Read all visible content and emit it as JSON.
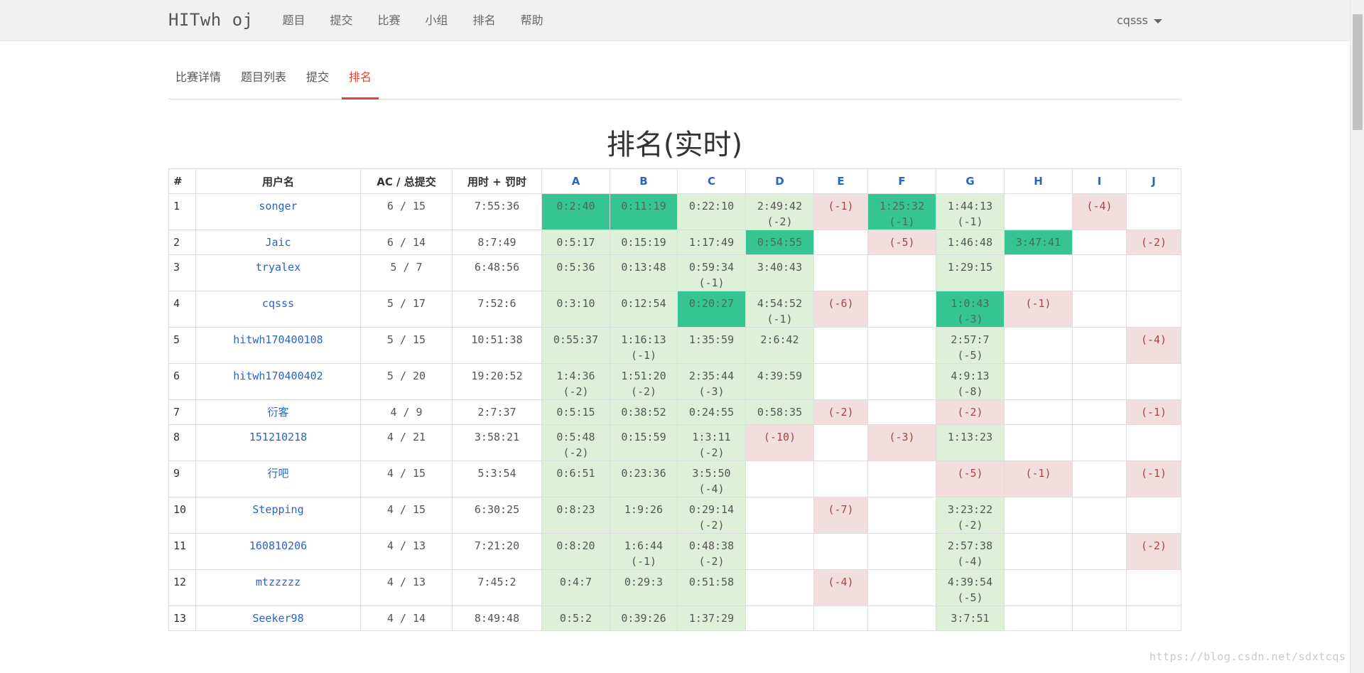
{
  "navbar": {
    "brand": "HITwh oj",
    "items": [
      "题目",
      "提交",
      "比赛",
      "小组",
      "排名",
      "帮助"
    ],
    "user": "cqsss"
  },
  "contest_tabs": [
    "比赛详情",
    "题目列表",
    "提交",
    "排名"
  ],
  "active_tab": "排名",
  "page_title": "排名(实时)",
  "table": {
    "headers": [
      "#",
      "用户名",
      "AC / 总提交",
      "用时 + 罚时"
    ],
    "problems": [
      "A",
      "B",
      "C",
      "D",
      "E",
      "F",
      "G",
      "H",
      "I",
      "J"
    ],
    "rows": [
      {
        "rank": "1",
        "user": "songer",
        "ac": "6 / 15",
        "time": "7:55:36",
        "cells": [
          {
            "s": "fb",
            "t": "0:2:40",
            "p": ""
          },
          {
            "s": "fb",
            "t": "0:11:19",
            "p": ""
          },
          {
            "s": "ac",
            "t": "0:22:10",
            "p": ""
          },
          {
            "s": "ac",
            "t": "2:49:42",
            "p": "(-2)"
          },
          {
            "s": "wa",
            "t": "",
            "p": "(-1)"
          },
          {
            "s": "fb",
            "t": "1:25:32",
            "p": "(-1)"
          },
          {
            "s": "ac",
            "t": "1:44:13",
            "p": "(-1)"
          },
          {
            "s": "",
            "t": "",
            "p": ""
          },
          {
            "s": "wa",
            "t": "",
            "p": "(-4)"
          },
          {
            "s": "",
            "t": "",
            "p": ""
          }
        ]
      },
      {
        "rank": "2",
        "user": "Jaic",
        "ac": "6 / 14",
        "time": "8:7:49",
        "cells": [
          {
            "s": "ac",
            "t": "0:5:17",
            "p": ""
          },
          {
            "s": "ac",
            "t": "0:15:19",
            "p": ""
          },
          {
            "s": "ac",
            "t": "1:17:49",
            "p": ""
          },
          {
            "s": "fb",
            "t": "0:54:55",
            "p": ""
          },
          {
            "s": "",
            "t": "",
            "p": ""
          },
          {
            "s": "wa",
            "t": "",
            "p": "(-5)"
          },
          {
            "s": "ac",
            "t": "1:46:48",
            "p": ""
          },
          {
            "s": "fb",
            "t": "3:47:41",
            "p": ""
          },
          {
            "s": "",
            "t": "",
            "p": ""
          },
          {
            "s": "wa",
            "t": "",
            "p": "(-2)"
          }
        ]
      },
      {
        "rank": "3",
        "user": "tryalex",
        "ac": "5 / 7",
        "time": "6:48:56",
        "cells": [
          {
            "s": "ac",
            "t": "0:5:36",
            "p": ""
          },
          {
            "s": "ac",
            "t": "0:13:48",
            "p": ""
          },
          {
            "s": "ac",
            "t": "0:59:34",
            "p": "(-1)"
          },
          {
            "s": "ac",
            "t": "3:40:43",
            "p": ""
          },
          {
            "s": "",
            "t": "",
            "p": ""
          },
          {
            "s": "",
            "t": "",
            "p": ""
          },
          {
            "s": "ac",
            "t": "1:29:15",
            "p": ""
          },
          {
            "s": "",
            "t": "",
            "p": ""
          },
          {
            "s": "",
            "t": "",
            "p": ""
          },
          {
            "s": "",
            "t": "",
            "p": ""
          }
        ]
      },
      {
        "rank": "4",
        "user": "cqsss",
        "ac": "5 / 17",
        "time": "7:52:6",
        "cells": [
          {
            "s": "ac",
            "t": "0:3:10",
            "p": ""
          },
          {
            "s": "ac",
            "t": "0:12:54",
            "p": ""
          },
          {
            "s": "fb",
            "t": "0:20:27",
            "p": ""
          },
          {
            "s": "ac",
            "t": "4:54:52",
            "p": "(-1)"
          },
          {
            "s": "wa",
            "t": "",
            "p": "(-6)"
          },
          {
            "s": "",
            "t": "",
            "p": ""
          },
          {
            "s": "fb",
            "t": "1:0:43",
            "p": "(-3)"
          },
          {
            "s": "wa",
            "t": "",
            "p": "(-1)"
          },
          {
            "s": "",
            "t": "",
            "p": ""
          },
          {
            "s": "",
            "t": "",
            "p": ""
          }
        ]
      },
      {
        "rank": "5",
        "user": "hitwh170400108",
        "ac": "5 / 15",
        "time": "10:51:38",
        "cells": [
          {
            "s": "ac",
            "t": "0:55:37",
            "p": ""
          },
          {
            "s": "ac",
            "t": "1:16:13",
            "p": "(-1)"
          },
          {
            "s": "ac",
            "t": "1:35:59",
            "p": ""
          },
          {
            "s": "ac",
            "t": "2:6:42",
            "p": ""
          },
          {
            "s": "",
            "t": "",
            "p": ""
          },
          {
            "s": "",
            "t": "",
            "p": ""
          },
          {
            "s": "ac",
            "t": "2:57:7",
            "p": "(-5)"
          },
          {
            "s": "",
            "t": "",
            "p": ""
          },
          {
            "s": "",
            "t": "",
            "p": ""
          },
          {
            "s": "wa",
            "t": "",
            "p": "(-4)"
          }
        ]
      },
      {
        "rank": "6",
        "user": "hitwh170400402",
        "ac": "5 / 20",
        "time": "19:20:52",
        "cells": [
          {
            "s": "ac",
            "t": "1:4:36",
            "p": "(-2)"
          },
          {
            "s": "ac",
            "t": "1:51:20",
            "p": "(-2)"
          },
          {
            "s": "ac",
            "t": "2:35:44",
            "p": "(-3)"
          },
          {
            "s": "ac",
            "t": "4:39:59",
            "p": ""
          },
          {
            "s": "",
            "t": "",
            "p": ""
          },
          {
            "s": "",
            "t": "",
            "p": ""
          },
          {
            "s": "ac",
            "t": "4:9:13",
            "p": "(-8)"
          },
          {
            "s": "",
            "t": "",
            "p": ""
          },
          {
            "s": "",
            "t": "",
            "p": ""
          },
          {
            "s": "",
            "t": "",
            "p": ""
          }
        ]
      },
      {
        "rank": "7",
        "user": "衍客",
        "ac": "4 / 9",
        "time": "2:7:37",
        "cells": [
          {
            "s": "ac",
            "t": "0:5:15",
            "p": ""
          },
          {
            "s": "ac",
            "t": "0:38:52",
            "p": ""
          },
          {
            "s": "ac",
            "t": "0:24:55",
            "p": ""
          },
          {
            "s": "ac",
            "t": "0:58:35",
            "p": ""
          },
          {
            "s": "wa",
            "t": "",
            "p": "(-2)"
          },
          {
            "s": "",
            "t": "",
            "p": ""
          },
          {
            "s": "wa",
            "t": "",
            "p": "(-2)"
          },
          {
            "s": "",
            "t": "",
            "p": ""
          },
          {
            "s": "",
            "t": "",
            "p": ""
          },
          {
            "s": "wa",
            "t": "",
            "p": "(-1)"
          }
        ]
      },
      {
        "rank": "8",
        "user": "151210218",
        "ac": "4 / 21",
        "time": "3:58:21",
        "cells": [
          {
            "s": "ac",
            "t": "0:5:48",
            "p": "(-2)"
          },
          {
            "s": "ac",
            "t": "0:15:59",
            "p": ""
          },
          {
            "s": "ac",
            "t": "1:3:11",
            "p": "(-2)"
          },
          {
            "s": "wa",
            "t": "",
            "p": "(-10)"
          },
          {
            "s": "",
            "t": "",
            "p": ""
          },
          {
            "s": "wa",
            "t": "",
            "p": "(-3)"
          },
          {
            "s": "ac",
            "t": "1:13:23",
            "p": ""
          },
          {
            "s": "",
            "t": "",
            "p": ""
          },
          {
            "s": "",
            "t": "",
            "p": ""
          },
          {
            "s": "",
            "t": "",
            "p": ""
          }
        ]
      },
      {
        "rank": "9",
        "user": "行吧",
        "ac": "4 / 15",
        "time": "5:3:54",
        "cells": [
          {
            "s": "ac",
            "t": "0:6:51",
            "p": ""
          },
          {
            "s": "ac",
            "t": "0:23:36",
            "p": ""
          },
          {
            "s": "ac",
            "t": "3:5:50",
            "p": "(-4)"
          },
          {
            "s": "",
            "t": "",
            "p": ""
          },
          {
            "s": "",
            "t": "",
            "p": ""
          },
          {
            "s": "",
            "t": "",
            "p": ""
          },
          {
            "s": "wa",
            "t": "",
            "p": "(-5)"
          },
          {
            "s": "wa",
            "t": "",
            "p": "(-1)"
          },
          {
            "s": "",
            "t": "",
            "p": ""
          },
          {
            "s": "wa",
            "t": "",
            "p": "(-1)"
          }
        ]
      },
      {
        "rank": "10",
        "user": "Stepping",
        "ac": "4 / 15",
        "time": "6:30:25",
        "cells": [
          {
            "s": "ac",
            "t": "0:8:23",
            "p": ""
          },
          {
            "s": "ac",
            "t": "1:9:26",
            "p": ""
          },
          {
            "s": "ac",
            "t": "0:29:14",
            "p": "(-2)"
          },
          {
            "s": "",
            "t": "",
            "p": ""
          },
          {
            "s": "wa",
            "t": "",
            "p": "(-7)"
          },
          {
            "s": "",
            "t": "",
            "p": ""
          },
          {
            "s": "ac",
            "t": "3:23:22",
            "p": "(-2)"
          },
          {
            "s": "",
            "t": "",
            "p": ""
          },
          {
            "s": "",
            "t": "",
            "p": ""
          },
          {
            "s": "",
            "t": "",
            "p": ""
          }
        ]
      },
      {
        "rank": "11",
        "user": "160810206",
        "ac": "4 / 13",
        "time": "7:21:20",
        "cells": [
          {
            "s": "ac",
            "t": "0:8:20",
            "p": ""
          },
          {
            "s": "ac",
            "t": "1:6:44",
            "p": "(-1)"
          },
          {
            "s": "ac",
            "t": "0:48:38",
            "p": "(-2)"
          },
          {
            "s": "",
            "t": "",
            "p": ""
          },
          {
            "s": "",
            "t": "",
            "p": ""
          },
          {
            "s": "",
            "t": "",
            "p": ""
          },
          {
            "s": "ac",
            "t": "2:57:38",
            "p": "(-4)"
          },
          {
            "s": "",
            "t": "",
            "p": ""
          },
          {
            "s": "",
            "t": "",
            "p": ""
          },
          {
            "s": "wa",
            "t": "",
            "p": "(-2)"
          }
        ]
      },
      {
        "rank": "12",
        "user": "mtzzzzz",
        "ac": "4 / 13",
        "time": "7:45:2",
        "cells": [
          {
            "s": "ac",
            "t": "0:4:7",
            "p": ""
          },
          {
            "s": "ac",
            "t": "0:29:3",
            "p": ""
          },
          {
            "s": "ac",
            "t": "0:51:58",
            "p": ""
          },
          {
            "s": "",
            "t": "",
            "p": ""
          },
          {
            "s": "wa",
            "t": "",
            "p": "(-4)"
          },
          {
            "s": "",
            "t": "",
            "p": ""
          },
          {
            "s": "ac",
            "t": "4:39:54",
            "p": "(-5)"
          },
          {
            "s": "",
            "t": "",
            "p": ""
          },
          {
            "s": "",
            "t": "",
            "p": ""
          },
          {
            "s": "",
            "t": "",
            "p": ""
          }
        ]
      },
      {
        "rank": "13",
        "user": "Seeker98",
        "ac": "4 / 14",
        "time": "8:49:48",
        "cells": [
          {
            "s": "ac",
            "t": "0:5:2",
            "p": ""
          },
          {
            "s": "ac",
            "t": "0:39:26",
            "p": ""
          },
          {
            "s": "ac",
            "t": "1:37:29",
            "p": ""
          },
          {
            "s": "",
            "t": "",
            "p": ""
          },
          {
            "s": "",
            "t": "",
            "p": ""
          },
          {
            "s": "",
            "t": "",
            "p": ""
          },
          {
            "s": "ac",
            "t": "3:7:51",
            "p": ""
          },
          {
            "s": "",
            "t": "",
            "p": ""
          },
          {
            "s": "",
            "t": "",
            "p": ""
          },
          {
            "s": "",
            "t": "",
            "p": ""
          }
        ]
      }
    ]
  },
  "watermark": "https://blog.csdn.net/sdxtcqs",
  "colors": {
    "accepted": "#dff0d8",
    "first_blood": "#35c492",
    "wrong": "#f2dede",
    "active_tab": "#d9453b",
    "link": "#2a64c6"
  }
}
